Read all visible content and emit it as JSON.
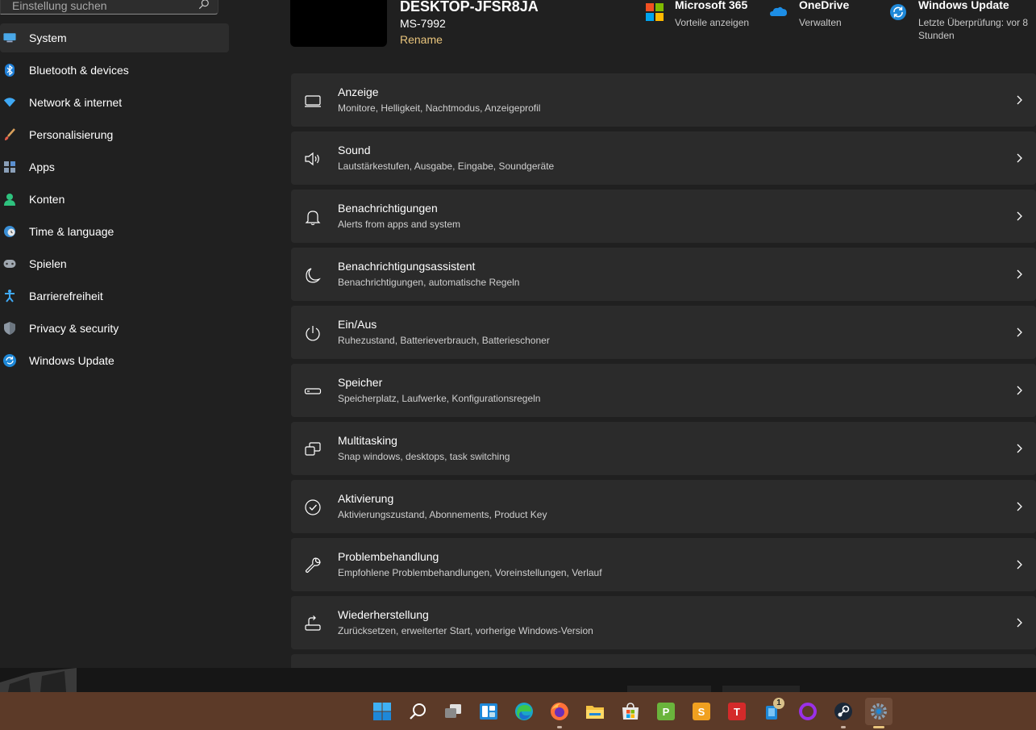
{
  "sidebar": {
    "search_placeholder": "Einstellung suchen",
    "items": [
      {
        "label": "System",
        "icon": "system-icon"
      },
      {
        "label": "Bluetooth & devices",
        "icon": "bluetooth-icon"
      },
      {
        "label": "Network & internet",
        "icon": "wifi-icon"
      },
      {
        "label": "Personalisierung",
        "icon": "brush-icon"
      },
      {
        "label": "Apps",
        "icon": "apps-icon"
      },
      {
        "label": "Konten",
        "icon": "account-icon"
      },
      {
        "label": "Time & language",
        "icon": "clock-globe-icon"
      },
      {
        "label": "Spielen",
        "icon": "gamepad-icon"
      },
      {
        "label": "Barrierefreiheit",
        "icon": "accessibility-icon"
      },
      {
        "label": "Privacy & security",
        "icon": "shield-icon"
      },
      {
        "label": "Windows Update",
        "icon": "update-icon"
      }
    ],
    "active_index": 0
  },
  "header": {
    "pc_name": "DESKTOP-JFSR8JA",
    "pc_model": "MS-7992",
    "rename_label": "Rename",
    "cards": [
      {
        "title": "Microsoft 365",
        "subtitle": "Vorteile anzeigen",
        "icon": "microsoft-logo-icon"
      },
      {
        "title": "OneDrive",
        "subtitle": "Verwalten",
        "icon": "onedrive-cloud-icon"
      },
      {
        "title": "Windows Update",
        "subtitle": "Letzte Überprüfung: vor 8 Stunden",
        "icon": "update-icon"
      }
    ]
  },
  "settings": [
    {
      "title": "Anzeige",
      "subtitle": "Monitore, Helligkeit, Nachtmodus, Anzeigeprofil",
      "icon": "monitor-icon"
    },
    {
      "title": "Sound",
      "subtitle": "Lautstärkestufen, Ausgabe, Eingabe, Soundgeräte",
      "icon": "speaker-icon"
    },
    {
      "title": "Benachrichtigungen",
      "subtitle": "Alerts from apps and system",
      "icon": "bell-icon"
    },
    {
      "title": "Benachrichtigungsassistent",
      "subtitle": "Benachrichtigungen, automatische Regeln",
      "icon": "moon-icon"
    },
    {
      "title": "Ein/Aus",
      "subtitle": "Ruhezustand, Batterieverbrauch, Batterieschoner",
      "icon": "power-icon"
    },
    {
      "title": "Speicher",
      "subtitle": "Speicherplatz, Laufwerke, Konfigurationsregeln",
      "icon": "drive-icon"
    },
    {
      "title": "Multitasking",
      "subtitle": "Snap windows, desktops, task switching",
      "icon": "multitasking-icon"
    },
    {
      "title": "Aktivierung",
      "subtitle": "Aktivierungszustand, Abonnements, Product Key",
      "icon": "check-circle-icon"
    },
    {
      "title": "Problembehandlung",
      "subtitle": "Empfohlene Problembehandlungen, Voreinstellungen, Verlauf",
      "icon": "wrench-icon"
    },
    {
      "title": "Wiederherstellung",
      "subtitle": "Zurücksetzen, erweiterter Start, vorherige Windows-Version",
      "icon": "recovery-icon"
    }
  ],
  "taskbar": {
    "apps": [
      {
        "name": "start-icon"
      },
      {
        "name": "search-icon"
      },
      {
        "name": "task-view-icon"
      },
      {
        "name": "widgets-icon"
      },
      {
        "name": "edge-icon"
      },
      {
        "name": "firefox-icon"
      },
      {
        "name": "file-explorer-icon"
      },
      {
        "name": "store-icon"
      },
      {
        "name": "p-app-icon",
        "letter": "P"
      },
      {
        "name": "s-app-icon",
        "letter": "S"
      },
      {
        "name": "t-app-icon",
        "letter": "T"
      },
      {
        "name": "phone-app-icon",
        "badge": "1"
      },
      {
        "name": "ring-app-icon"
      },
      {
        "name": "steam-icon"
      },
      {
        "name": "settings-gear-icon"
      }
    ]
  },
  "colors": {
    "accent": "#e8c47c",
    "window_bg": "#202020",
    "card_bg": "#2b2b2b",
    "taskbar_bg": "#5c3a28"
  }
}
